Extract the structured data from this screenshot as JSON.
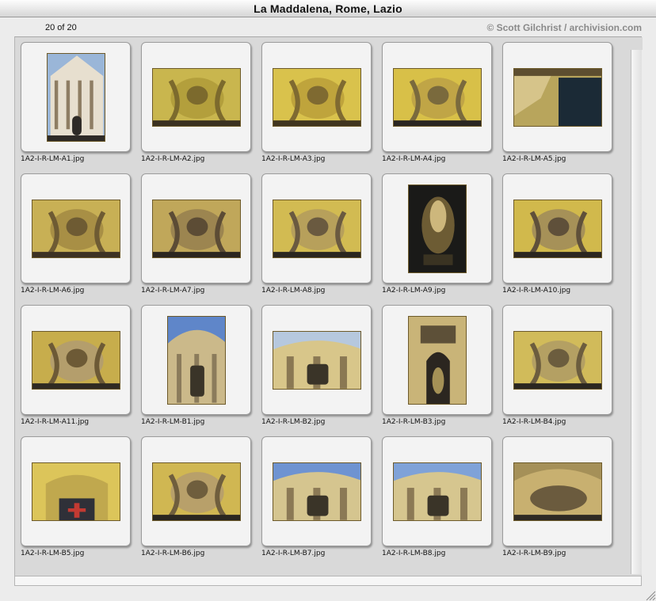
{
  "window": {
    "title": "La Maddalena, Rome, Lazio"
  },
  "infobar": {
    "count": "20 of 20",
    "credit": "© Scott Gilchrist / archivision.com"
  },
  "items": [
    {
      "filename": "1A2-I-R-LM-A1.jpg",
      "orientation": "portrait",
      "palette": [
        "#9ab6d8",
        "#e7dfcf",
        "#8e7d63",
        "#2e2a26"
      ],
      "motif": "facade"
    },
    {
      "filename": "1A2-I-R-LM-A2.jpg",
      "orientation": "landscape",
      "palette": [
        "#c9b64e",
        "#b39f3c",
        "#7c6a2d",
        "#3a3120"
      ],
      "motif": "scroll"
    },
    {
      "filename": "1A2-I-R-LM-A3.jpg",
      "orientation": "landscape",
      "palette": [
        "#d9c24c",
        "#bfa43c",
        "#7f6a31",
        "#40351f"
      ],
      "motif": "cartouche"
    },
    {
      "filename": "1A2-I-R-LM-A4.jpg",
      "orientation": "landscape",
      "palette": [
        "#d8c048",
        "#c0a546",
        "#7a6a3d",
        "#2a2622"
      ],
      "motif": "cartouche"
    },
    {
      "filename": "1A2-I-R-LM-A5.jpg",
      "orientation": "landscape",
      "palette": [
        "#b8a55c",
        "#d6c48a",
        "#5d4e30",
        "#1b2a36"
      ],
      "motif": "doorway"
    },
    {
      "filename": "1A2-I-R-LM-A6.jpg",
      "orientation": "landscape",
      "palette": [
        "#c8b055",
        "#a88f45",
        "#6e5b33",
        "#3d3224"
      ],
      "motif": "relief"
    },
    {
      "filename": "1A2-I-R-LM-A7.jpg",
      "orientation": "landscape",
      "palette": [
        "#c0a75a",
        "#9c8550",
        "#5c4c35",
        "#2c2620"
      ],
      "motif": "statues"
    },
    {
      "filename": "1A2-I-R-LM-A8.jpg",
      "orientation": "landscape",
      "palette": [
        "#d2bb52",
        "#b7a05b",
        "#6a5a40",
        "#2a2620"
      ],
      "motif": "statues"
    },
    {
      "filename": "1A2-I-R-LM-A9.jpg",
      "orientation": "portrait",
      "palette": [
        "#1a1a18",
        "#6d5c34",
        "#cdb77c",
        "#3a3322"
      ],
      "motif": "statue-dark"
    },
    {
      "filename": "1A2-I-R-LM-A10.jpg",
      "orientation": "landscape",
      "palette": [
        "#d1b94c",
        "#a69158",
        "#5f503a",
        "#2b2620"
      ],
      "motif": "statues"
    },
    {
      "filename": "1A2-I-R-LM-A11.jpg",
      "orientation": "landscape",
      "palette": [
        "#c7ad4c",
        "#b49e6c",
        "#6d5a36",
        "#2f2a22"
      ],
      "motif": "angel"
    },
    {
      "filename": "1A2-I-R-LM-B1.jpg",
      "orientation": "portrait",
      "palette": [
        "#5f86c9",
        "#cbb98a",
        "#8b7b5b",
        "#3a3428"
      ],
      "motif": "sky-facade"
    },
    {
      "filename": "1A2-I-R-LM-B2.jpg",
      "orientation": "landscape",
      "palette": [
        "#b6c8de",
        "#d8c68a",
        "#8a7853",
        "#3a3428"
      ],
      "motif": "sky-facade"
    },
    {
      "filename": "1A2-I-R-LM-B3.jpg",
      "orientation": "portrait",
      "palette": [
        "#c9b478",
        "#a59156",
        "#5d5038",
        "#2b2620"
      ],
      "motif": "niche"
    },
    {
      "filename": "1A2-I-R-LM-B4.jpg",
      "orientation": "landscape",
      "palette": [
        "#d1bb5a",
        "#b4a063",
        "#6c5d3e",
        "#2a2620"
      ],
      "motif": "cartouche"
    },
    {
      "filename": "1A2-I-R-LM-B5.jpg",
      "orientation": "landscape",
      "palette": [
        "#dcc55a",
        "#c0a84e",
        "#7b6a3f",
        "#2f3038"
      ],
      "motif": "window"
    },
    {
      "filename": "1A2-I-R-LM-B6.jpg",
      "orientation": "landscape",
      "palette": [
        "#d0b752",
        "#b8a06a",
        "#6f5e3d",
        "#2a2620"
      ],
      "motif": "cartouche"
    },
    {
      "filename": "1A2-I-R-LM-B7.jpg",
      "orientation": "landscape",
      "palette": [
        "#6e93d1",
        "#d5c58f",
        "#8b7955",
        "#3a3428"
      ],
      "motif": "sky-facade"
    },
    {
      "filename": "1A2-I-R-LM-B8.jpg",
      "orientation": "landscape",
      "palette": [
        "#7fa2d8",
        "#d6c68f",
        "#8b7955",
        "#3a3428"
      ],
      "motif": "sky-facade"
    },
    {
      "filename": "1A2-I-R-LM-B9.jpg",
      "orientation": "landscape",
      "palette": [
        "#c8b070",
        "#a59058",
        "#6b5b3e",
        "#2f2a24"
      ],
      "motif": "arch"
    }
  ]
}
